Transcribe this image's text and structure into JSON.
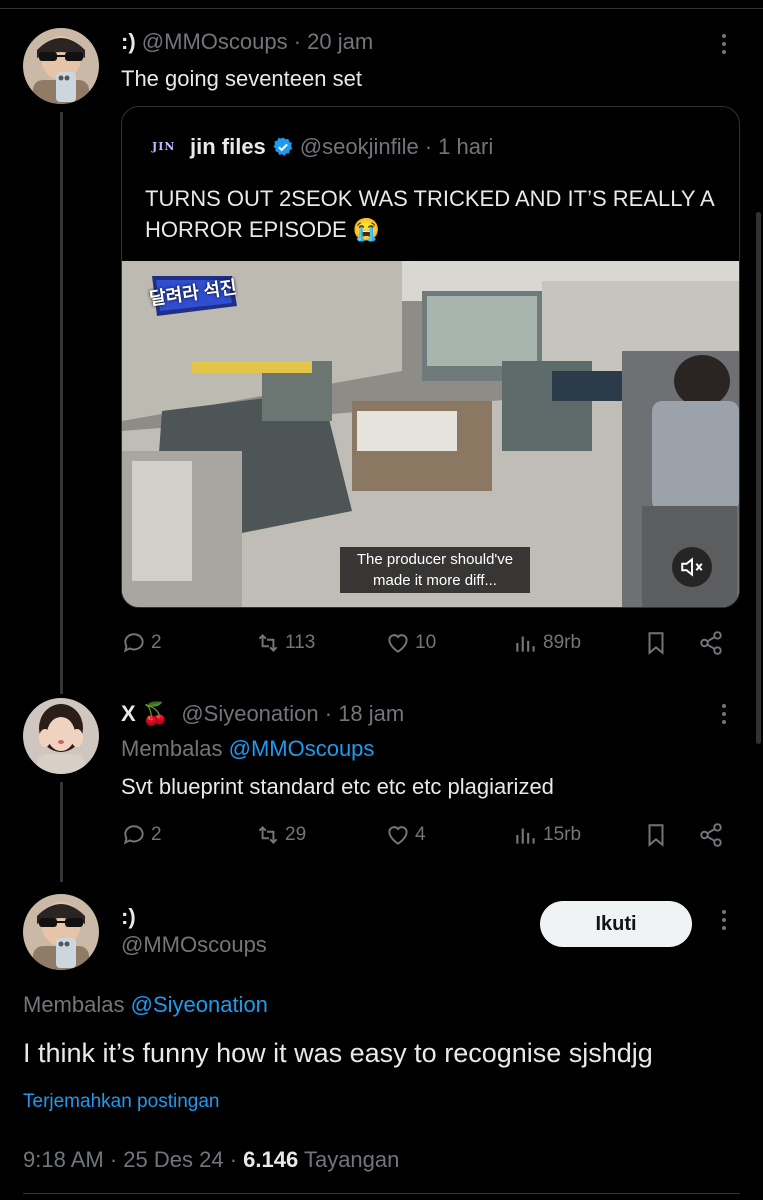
{
  "tweet1": {
    "name": ":)",
    "handle": "@MMOscoups",
    "time": "· 20 jam",
    "text": "The going seventeen set",
    "quote": {
      "logo": "JIN",
      "name": "jin files",
      "handle": "@seokjinfile",
      "time": "· 1 hari",
      "text": "TURNS OUT 2SEOK WAS TRICKED AND IT’S REALLY A HORROR EPISODE 😭",
      "video_overlay_title": "달려라 석진",
      "caption": "The producer should've made it more diff...",
      "mute_icon": "speaker-muted-icon"
    },
    "actions": {
      "replies": "2",
      "reposts": "113",
      "likes": "10",
      "views": "89rb"
    }
  },
  "tweet2": {
    "name": "X 🍒",
    "handle": "@Siyeonation",
    "time": "· 18 jam",
    "replying_label": "Membalas",
    "replying_to": "@MMOscoups",
    "text": "Svt blueprint standard etc etc etc plagiarized",
    "actions": {
      "replies": "2",
      "reposts": "29",
      "likes": "4",
      "views": "15rb"
    }
  },
  "main": {
    "name": ":)",
    "handle": "@MMOscoups",
    "follow_label": "Ikuti",
    "replying_label": "Membalas",
    "replying_to": "@Siyeonation",
    "text": "I think it’s funny how it was easy to recognise sjshdjg",
    "translate": "Terjemahkan postingan",
    "time": "9:18 AM",
    "date": "25 Des 24",
    "views": "6.146",
    "views_label": "Tayangan"
  },
  "colors": {
    "accent": "#1d9bf0",
    "muted": "#71767b",
    "text": "#e7e9ea",
    "verified": "#1d9bf0"
  }
}
